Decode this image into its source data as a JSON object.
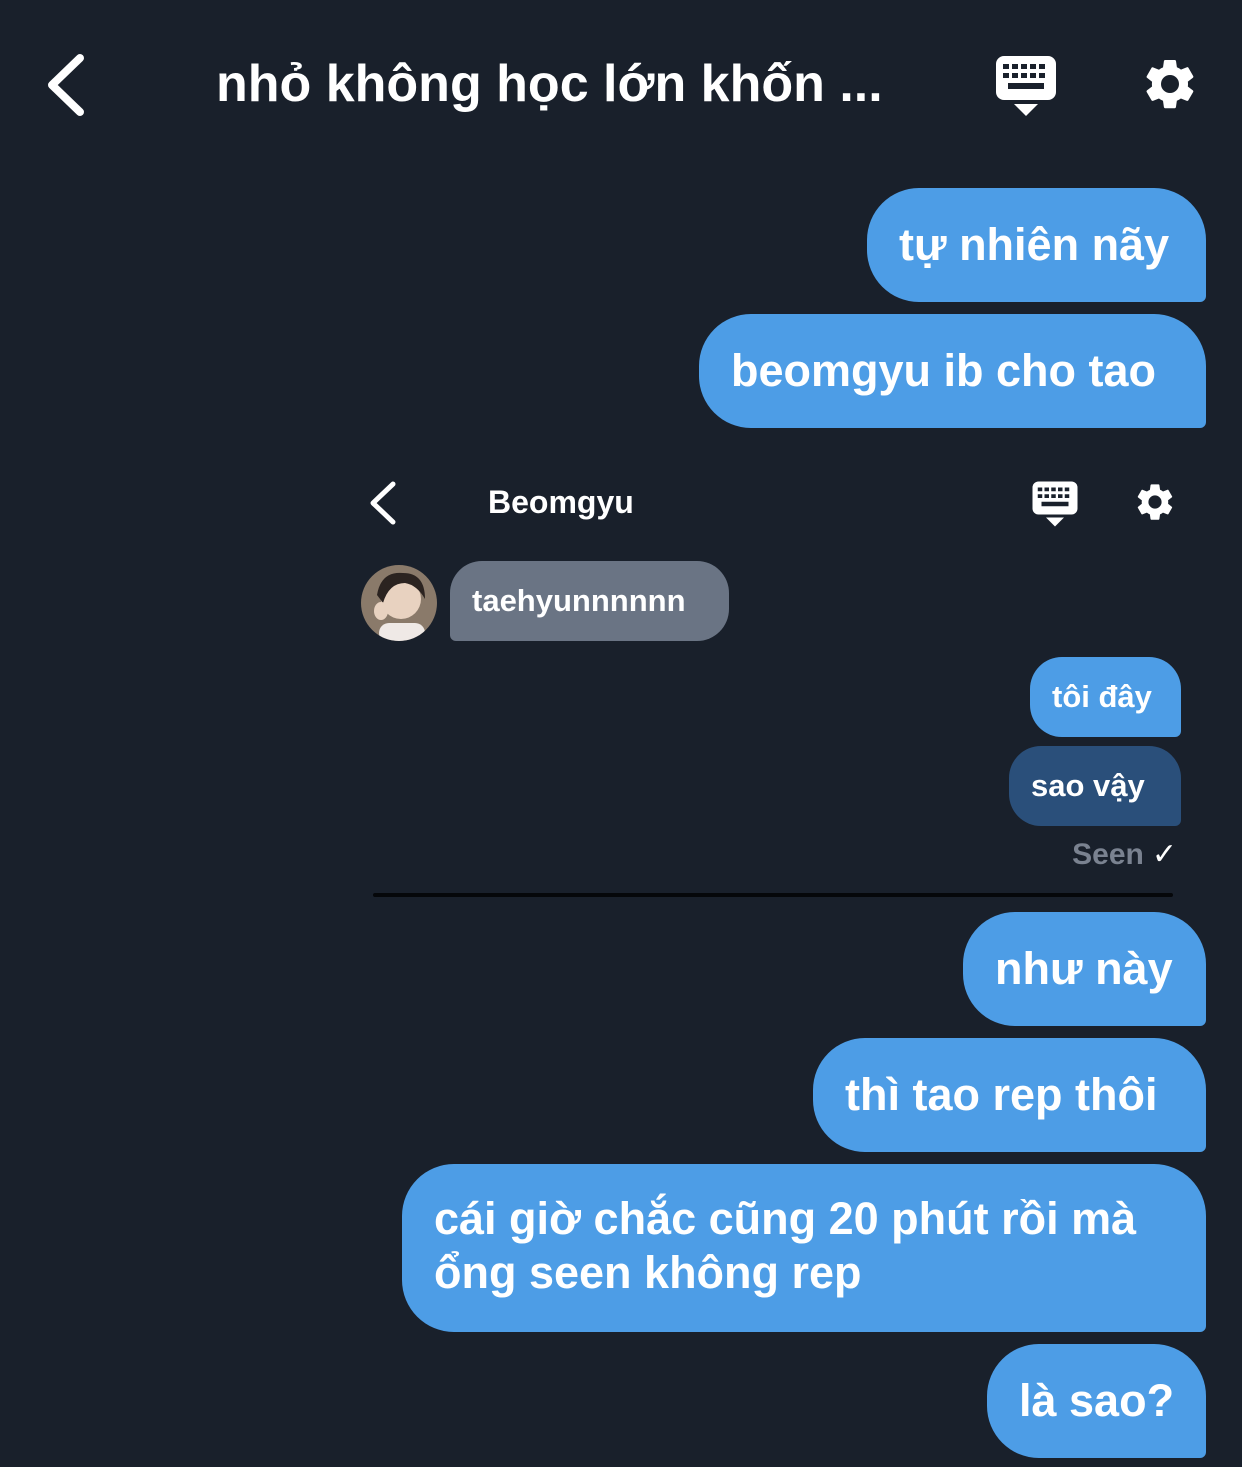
{
  "header": {
    "title": "nhỏ không học lớn khốn ...",
    "back_icon": "chevron-left-icon",
    "keyboard_icon": "keyboard-icon",
    "settings_icon": "gear-icon"
  },
  "messages": [
    {
      "text": "tự nhiên nãy"
    },
    {
      "text": "beomgyu ib cho tao"
    },
    {
      "text": "như này"
    },
    {
      "text": "thì tao rep thôi"
    },
    {
      "text": "cái giờ chắc cũng 20 phút rồi mà ổng seen không rep"
    },
    {
      "text": "là sao?"
    }
  ],
  "embedded_chat": {
    "name": "Beomgyu",
    "received": "taehyunnnnnn",
    "sent": [
      {
        "text": "tôi đây"
      },
      {
        "text": "sao vậy"
      }
    ],
    "seen_label": "Seen",
    "seen_mark": "✓"
  },
  "colors": {
    "background": "#19202b",
    "sent_bubble": "#4d9de6",
    "received_bubble": "#6a7484",
    "pending_bubble": "#2a4f7a"
  }
}
